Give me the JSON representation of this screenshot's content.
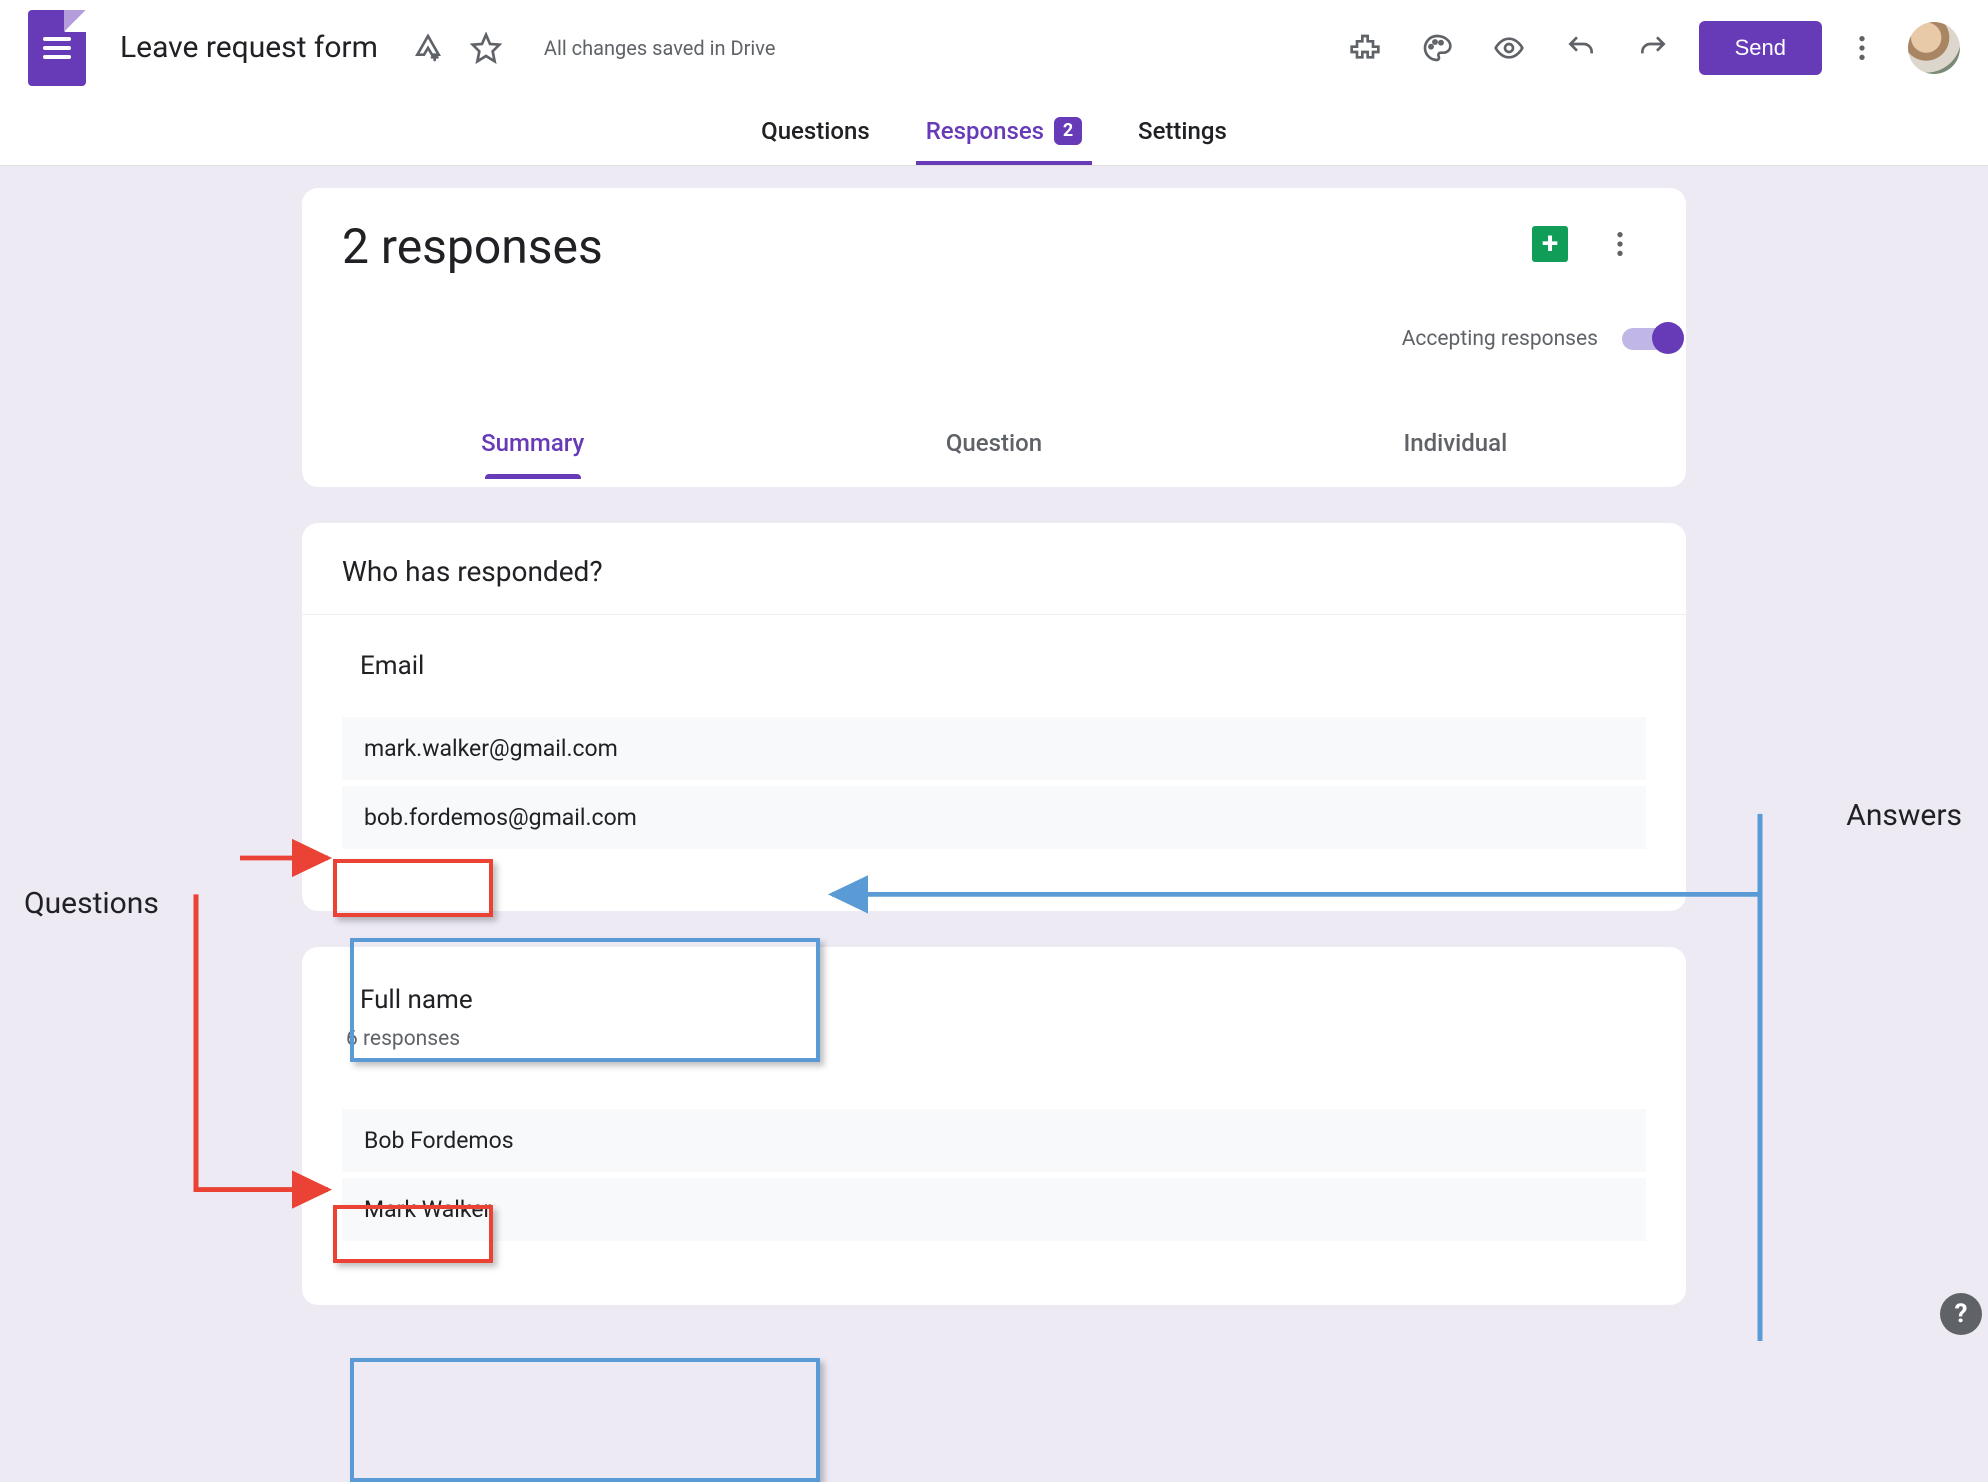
{
  "header": {
    "title": "Leave request form",
    "drive_status": "All changes saved in Drive",
    "send_label": "Send"
  },
  "top_tabs": {
    "questions": "Questions",
    "responses": "Responses",
    "responses_badge": "2",
    "settings": "Settings"
  },
  "responses_card": {
    "title": "2 responses",
    "accepting_label": "Accepting responses",
    "tabs": {
      "summary": "Summary",
      "question": "Question",
      "individual": "Individual"
    }
  },
  "who_responded": {
    "section_title": "Who has responded?",
    "question_label": "Email",
    "answers": [
      "mark.walker@gmail.com",
      "bob.fordemos@gmail.com"
    ]
  },
  "full_name": {
    "question_label": "Full name",
    "subcount": "6 responses",
    "answers": [
      "Bob Fordemos",
      "Mark Walker"
    ]
  },
  "annotations": {
    "questions_label": "Questions",
    "answers_label": "Answers"
  }
}
